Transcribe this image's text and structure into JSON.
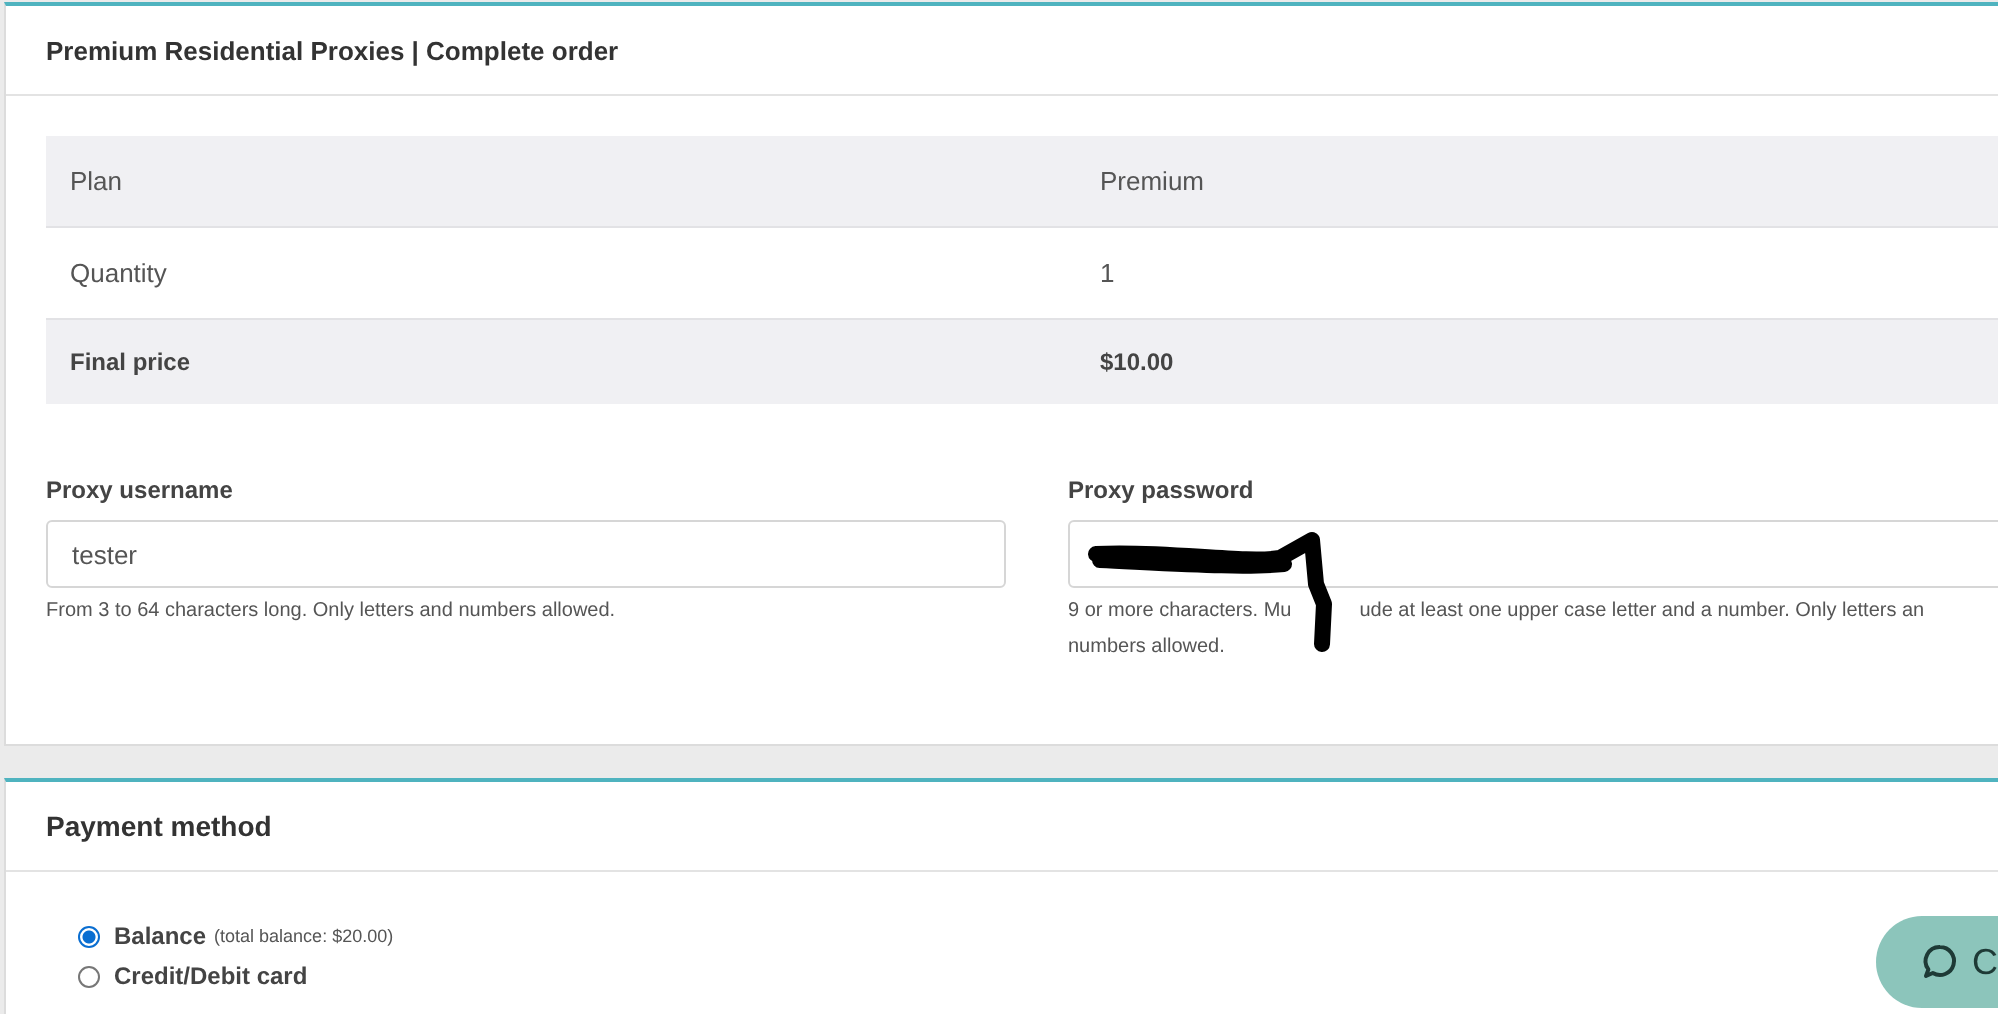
{
  "order_card": {
    "title": "Premium Residential Proxies | Complete order",
    "summary": [
      {
        "kind": "plain",
        "label": "Plan",
        "value": "Premium"
      },
      {
        "kind": "plain",
        "label": "Quantity",
        "value": "1"
      },
      {
        "kind": "total",
        "label": "Final price",
        "value": "$10.00"
      }
    ],
    "fields": [
      {
        "kind": "text",
        "label": "Proxy username",
        "value": "tester",
        "hint_parts": [
          "From 3 to 64 characters long. Only letters and numbers allowed."
        ]
      },
      {
        "kind": "redacted",
        "label": "Proxy password",
        "hint_parts": [
          "9 or more characters. Mu",
          "ude at least one upper case letter and a number. Only letters an",
          "numbers allowed."
        ]
      }
    ]
  },
  "payment_card": {
    "title": "Payment method",
    "options": [
      {
        "label": "Balance",
        "note": "(total balance: $20.00)",
        "selected": true
      },
      {
        "label": "Credit/Debit card",
        "selected": false
      }
    ]
  },
  "chat_button": {
    "label": "C"
  }
}
